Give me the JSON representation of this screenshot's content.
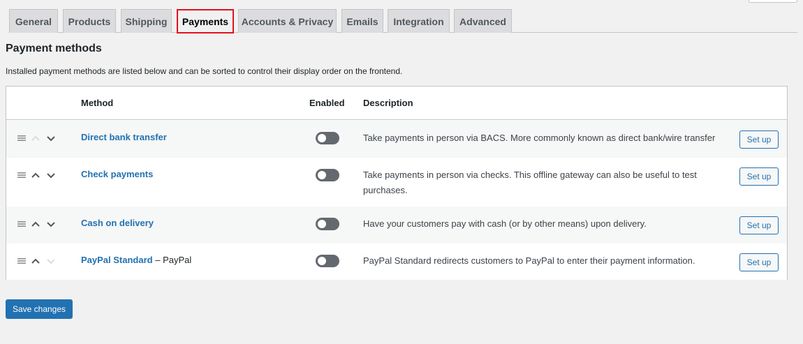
{
  "tabs": [
    {
      "label": "General",
      "active": false
    },
    {
      "label": "Products",
      "active": false
    },
    {
      "label": "Shipping",
      "active": false
    },
    {
      "label": "Payments",
      "active": true
    },
    {
      "label": "Accounts & Privacy",
      "active": false
    },
    {
      "label": "Emails",
      "active": false
    },
    {
      "label": "Integration",
      "active": false
    },
    {
      "label": "Advanced",
      "active": false
    }
  ],
  "section": {
    "title": "Payment methods",
    "intro": "Installed payment methods are listed below and can be sorted to control their display order on the frontend."
  },
  "table": {
    "headers": {
      "method": "Method",
      "enabled": "Enabled",
      "description": "Description"
    },
    "rows": [
      {
        "method": "Direct bank transfer",
        "suffix": "",
        "enabled": false,
        "description": "Take payments in person via BACS. More commonly known as direct bank/wire transfer",
        "action": "Set up",
        "up_enabled": false,
        "down_enabled": true
      },
      {
        "method": "Check payments",
        "suffix": "",
        "enabled": false,
        "description": "Take payments in person via checks. This offline gateway can also be useful to test purchases.",
        "action": "Set up",
        "up_enabled": true,
        "down_enabled": true
      },
      {
        "method": "Cash on delivery",
        "suffix": "",
        "enabled": false,
        "description": "Have your customers pay with cash (or by other means) upon delivery.",
        "action": "Set up",
        "up_enabled": true,
        "down_enabled": true
      },
      {
        "method": "PayPal Standard",
        "suffix": " – PayPal",
        "enabled": false,
        "description": "PayPal Standard redirects customers to PayPal to enter their payment information.",
        "action": "Set up",
        "up_enabled": true,
        "down_enabled": false
      }
    ]
  },
  "save_button": "Save changes",
  "icons": {
    "drag": "drag-handle-icon",
    "up": "chevron-up-icon",
    "down": "chevron-down-icon"
  },
  "colors": {
    "accent": "#2271b1",
    "active_tab_outline": "#e0121f",
    "toggle_off": "#646970"
  }
}
